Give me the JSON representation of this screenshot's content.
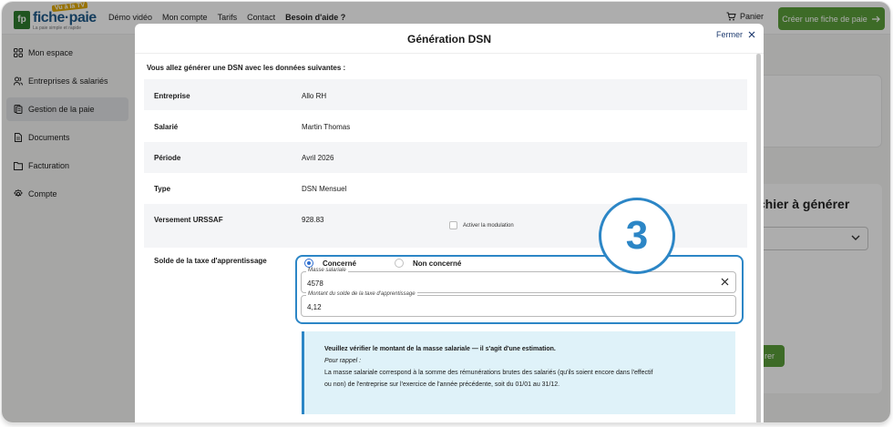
{
  "header": {
    "logo_text": "fiche·paie",
    "logo_tag": "Vu à la TV",
    "logo_sub": "La paie simple et rapide",
    "nav": [
      "Démo vidéo",
      "Mon compte",
      "Tarifs",
      "Contact",
      "Besoin d'aide ?"
    ],
    "cart_label": "Panier",
    "cta_label": "Créer une fiche de paie"
  },
  "sidebar": {
    "items": [
      {
        "label": "Mon espace",
        "icon": "grid-icon"
      },
      {
        "label": "Entreprises & salariés",
        "icon": "users-icon"
      },
      {
        "label": "Gestion de la paie",
        "icon": "payslip-icon"
      },
      {
        "label": "Documents",
        "icon": "document-icon"
      },
      {
        "label": "Facturation",
        "icon": "folder-icon"
      },
      {
        "label": "Compte",
        "icon": "gear-icon"
      }
    ]
  },
  "background": {
    "heading_fragment": "ichier à générer",
    "button_fragment": "rer"
  },
  "modal": {
    "title": "Génération DSN",
    "close_label": "Fermer",
    "intro": "Vous allez générer une DSN avec les données suivantes :",
    "rows": [
      {
        "label": "Entreprise",
        "value": "Allo RH"
      },
      {
        "label": "Salarié",
        "value": "Martin Thomas"
      },
      {
        "label": "Période",
        "value": "Avril 2026"
      },
      {
        "label": "Type",
        "value": "DSN Mensuel"
      },
      {
        "label": "Versement URSSAF",
        "value": "928.83"
      }
    ],
    "modulation_label": "Activer la modulation",
    "taxe_label": "Solde de la taxe d'apprentissage",
    "radio_concerne": "Concerné",
    "radio_non_concerne": "Non concerné",
    "masse_label": "Masse salariale",
    "masse_value": "4578",
    "montant_label": "Montant du solde de la taxe d'apprentissage",
    "montant_value": "4,12",
    "info_title": "Veuillez vérifier le montant de la masse salariale — il s'agit d'une estimation.",
    "info_subtitle": "Pour rappel :",
    "info_line1": "La masse salariale correspond à la somme des rémunérations brutes des salariés (qu'ils soient encore dans l'effectif",
    "info_line2": "ou non) de l'entreprise sur l'exercice de l'année précédente, soit du 01/01 au 31/12."
  },
  "annotation": {
    "step_number": "3",
    "color": "#2c86c6"
  },
  "colors": {
    "brand_green": "#5a9e3a",
    "brand_blue": "#1f5a8a",
    "info_bg": "#dff2f9",
    "radio_blue": "#2f6fd0"
  }
}
